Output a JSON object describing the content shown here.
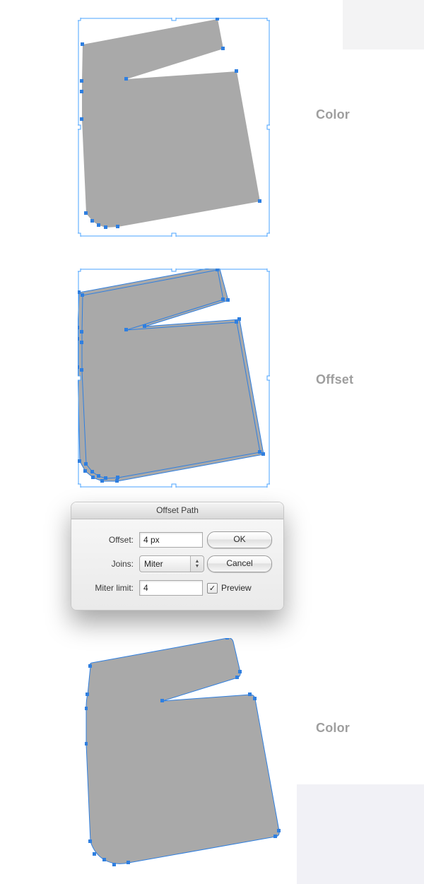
{
  "labels": {
    "fig1": "Color",
    "fig2": "Offset",
    "fig3": "Color"
  },
  "dialog": {
    "title": "Offset Path",
    "offset_label": "Offset:",
    "joins_label": "Joins:",
    "miter_label": "Miter limit:",
    "offset_value": "4 px",
    "joins_value": "Miter",
    "miter_value": "4",
    "ok_label": "OK",
    "cancel_label": "Cancel",
    "preview_label": "Preview",
    "preview_checked": "true"
  }
}
